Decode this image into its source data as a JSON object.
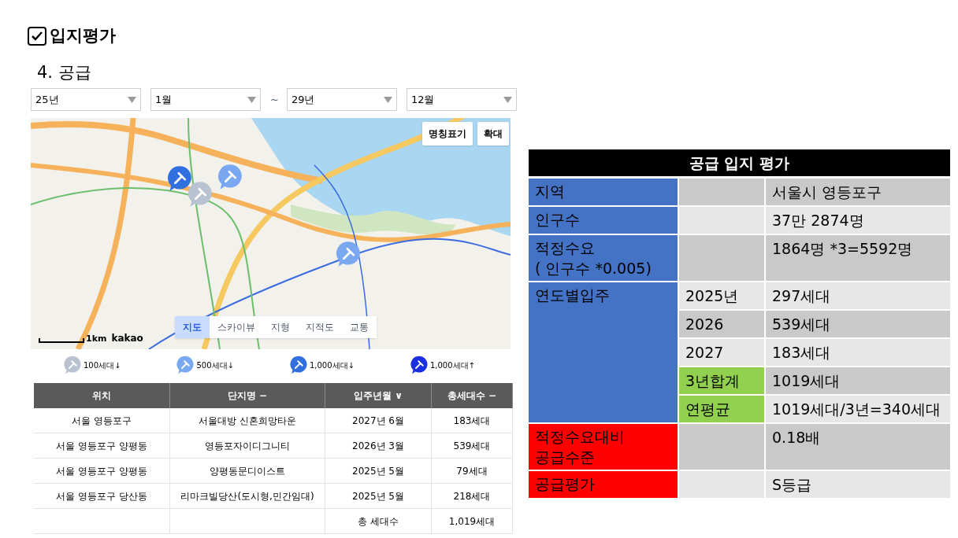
{
  "heading": {
    "checked": true,
    "title": "입지평가"
  },
  "section": "4. 공급",
  "filters": [
    {
      "value": "25년"
    },
    {
      "value": "1월"
    },
    {
      "separator": "~",
      "value": "29년"
    },
    {
      "value": "12월"
    }
  ],
  "map": {
    "buttons": [
      "명칭표기",
      "확대"
    ],
    "markers": [
      {
        "color": "#2f6fe0"
      },
      {
        "color": "#b8c2d0"
      },
      {
        "color": "#7aa8f0"
      },
      {
        "color": "#7aa8f0"
      }
    ],
    "tabs": [
      {
        "label": "지도",
        "selected": true
      },
      {
        "label": "스카이뷰",
        "selected": false
      },
      {
        "label": "지형",
        "selected": false
      },
      {
        "label": "지적도",
        "selected": false
      },
      {
        "label": "교통",
        "selected": false
      }
    ],
    "scale": "1km",
    "brand": "kakao"
  },
  "legend": [
    {
      "label": "100세대↓",
      "color": "#b8c2d0"
    },
    {
      "label": "500세대↓",
      "color": "#7aa8f0"
    },
    {
      "label": "1,000세대↓",
      "color": "#2f6fe0"
    },
    {
      "label": "1,000세대↑",
      "color": "#1a2fe0"
    }
  ],
  "table": {
    "columns": [
      "위치",
      "단지명 −",
      "입주년월 ∨",
      "총세대수 −"
    ],
    "rows": [
      [
        "서울 영등포구",
        "서울대방 신혼희망타운",
        "2027년 6월",
        "183세대"
      ],
      [
        "서울 영등포구 양평동",
        "영등포자이디그니티",
        "2026년 3월",
        "539세대"
      ],
      [
        "서울 영등포구 양평동",
        "양평동문디이스트",
        "2025년 5월",
        "79세대"
      ],
      [
        "서울 영등포구 당산동",
        "리마크빌당산(도시형,민간임대)",
        "2025년 5월",
        "218세대"
      ],
      [
        null,
        null,
        "총 세대수",
        "1,019세대"
      ]
    ]
  },
  "evaluation": {
    "title": "공급 입지 평가",
    "rows": [
      {
        "label": "지역",
        "color": "#4472c4",
        "subs": [
          {
            "middle": {
              "color": "#c9c9c9"
            },
            "value": {
              "text": "서울시 영등포구",
              "color": "#c9c9c9"
            }
          }
        ]
      },
      {
        "label": "인구수",
        "color": "#4472c4",
        "subs": [
          {
            "middle": {
              "color": "#e7e7e7"
            },
            "value": {
              "text": "37만 2874명",
              "color": "#e7e7e7"
            }
          }
        ]
      },
      {
        "label": "적정수요\n( 인구수 *0.005)",
        "color": "#4472c4",
        "subs": [
          {
            "middle": {
              "color": "#c9c9c9"
            },
            "value": {
              "text": "1864명 *3=5592명",
              "color": "#c9c9c9"
            }
          }
        ]
      },
      {
        "label": "연도별입주",
        "color": "#4472c4",
        "subs": [
          {
            "middle": {
              "text": "2025년",
              "color": "#e7e7e7"
            },
            "value": {
              "text": "297세대",
              "color": "#e7e7e7"
            }
          },
          {
            "middle": {
              "text": "2026",
              "color": "#c9c9c9"
            },
            "value": {
              "text": "539세대",
              "color": "#c9c9c9"
            }
          },
          {
            "middle": {
              "text": "2027",
              "color": "#e7e7e7"
            },
            "value": {
              "text": "183세대",
              "color": "#e7e7e7"
            }
          },
          {
            "middle": {
              "text": "3년합계",
              "color": "#92d050"
            },
            "value": {
              "text": "1019세대",
              "color": "#c9c9c9"
            }
          },
          {
            "middle": {
              "text": "연평균",
              "color": "#92d050"
            },
            "value": {
              "text": "1019세대/3년=340세대",
              "color": "#e7e7e7"
            }
          }
        ]
      },
      {
        "label": "적정수요대비\n공급수준",
        "color": "#ff0000",
        "subs": [
          {
            "middle": {
              "color": "#c9c9c9"
            },
            "value": {
              "text": "0.18배",
              "color": "#c9c9c9"
            }
          }
        ]
      },
      {
        "label": "공급평가",
        "color": "#ff0000",
        "subs": [
          {
            "middle": {
              "color": "#e7e7e7"
            },
            "value": {
              "text": "S등급",
              "color": "#e7e7e7"
            }
          }
        ]
      }
    ]
  }
}
